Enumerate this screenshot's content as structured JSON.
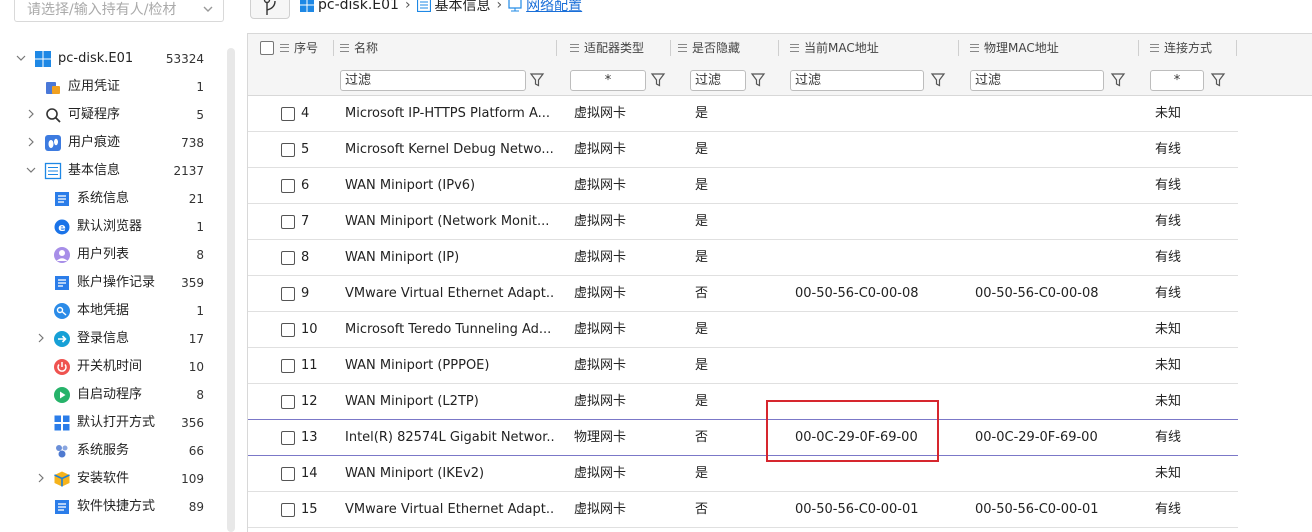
{
  "owner_select": {
    "placeholder": "请选择/输入持有人/检材"
  },
  "breadcrumb": {
    "items": [
      "pc-disk.E01",
      "基本信息",
      "网络配置"
    ]
  },
  "tree": [
    {
      "label": "pc-disk.E01",
      "count": "53324",
      "expand": "open",
      "icon": "windows-icon"
    },
    {
      "label": "应用凭证",
      "count": "1",
      "expand": "none",
      "icon": "credential-icon"
    },
    {
      "label": "可疑程序",
      "count": "5",
      "expand": "closed",
      "icon": "magnifier-icon"
    },
    {
      "label": "用户痕迹",
      "count": "738",
      "expand": "closed",
      "icon": "footprint-icon"
    },
    {
      "label": "基本信息",
      "count": "2137",
      "expand": "open",
      "icon": "list-icon"
    },
    {
      "label": "系统信息",
      "count": "21",
      "expand": "none",
      "icon": "system-info-icon"
    },
    {
      "label": "默认浏览器",
      "count": "1",
      "expand": "none",
      "icon": "browser-icon"
    },
    {
      "label": "用户列表",
      "count": "8",
      "expand": "none",
      "icon": "user-icon"
    },
    {
      "label": "账户操作记录",
      "count": "359",
      "expand": "none",
      "icon": "account-log-icon"
    },
    {
      "label": "本地凭据",
      "count": "1",
      "expand": "none",
      "icon": "key-icon"
    },
    {
      "label": "登录信息",
      "count": "17",
      "expand": "closed",
      "icon": "login-icon"
    },
    {
      "label": "开关机时间",
      "count": "10",
      "expand": "none",
      "icon": "power-icon"
    },
    {
      "label": "自启动程序",
      "count": "8",
      "expand": "none",
      "icon": "play-icon"
    },
    {
      "label": "默认打开方式",
      "count": "356",
      "expand": "none",
      "icon": "grid-icon"
    },
    {
      "label": "系统服务",
      "count": "66",
      "expand": "none",
      "icon": "service-icon"
    },
    {
      "label": "安装软件",
      "count": "109",
      "expand": "closed",
      "icon": "package-icon"
    },
    {
      "label": "软件快捷方式",
      "count": "89",
      "expand": "none",
      "icon": "shortcut-icon"
    }
  ],
  "columns": [
    {
      "key": "seq",
      "label": "序号"
    },
    {
      "key": "name",
      "label": "名称"
    },
    {
      "key": "adapter_type",
      "label": "适配器类型"
    },
    {
      "key": "hidden",
      "label": "是否隐藏"
    },
    {
      "key": "current_mac",
      "label": "当前MAC地址"
    },
    {
      "key": "physical_mac",
      "label": "物理MAC地址"
    },
    {
      "key": "connection",
      "label": "连接方式"
    }
  ],
  "filters": {
    "name": "过滤",
    "adapter_type": "*",
    "hidden": "过滤",
    "current_mac": "过滤",
    "physical_mac": "过滤",
    "connection": "*"
  },
  "rows": [
    {
      "seq": "4",
      "name": "Microsoft IP-HTTPS Platform A...",
      "adapter_type": "虚拟网卡",
      "hidden": "是",
      "current_mac": "",
      "physical_mac": "",
      "connection": "未知"
    },
    {
      "seq": "5",
      "name": "Microsoft Kernel Debug Netwo...",
      "adapter_type": "虚拟网卡",
      "hidden": "是",
      "current_mac": "",
      "physical_mac": "",
      "connection": "有线"
    },
    {
      "seq": "6",
      "name": "WAN Miniport (IPv6)",
      "adapter_type": "虚拟网卡",
      "hidden": "是",
      "current_mac": "",
      "physical_mac": "",
      "connection": "有线"
    },
    {
      "seq": "7",
      "name": "WAN Miniport (Network Monit...",
      "adapter_type": "虚拟网卡",
      "hidden": "是",
      "current_mac": "",
      "physical_mac": "",
      "connection": "有线"
    },
    {
      "seq": "8",
      "name": "WAN Miniport (IP)",
      "adapter_type": "虚拟网卡",
      "hidden": "是",
      "current_mac": "",
      "physical_mac": "",
      "connection": "有线"
    },
    {
      "seq": "9",
      "name": "VMware Virtual Ethernet Adapt...",
      "adapter_type": "虚拟网卡",
      "hidden": "否",
      "current_mac": "00-50-56-C0-00-08",
      "physical_mac": "00-50-56-C0-00-08",
      "connection": "有线"
    },
    {
      "seq": "10",
      "name": "Microsoft Teredo Tunneling Ad...",
      "adapter_type": "虚拟网卡",
      "hidden": "是",
      "current_mac": "",
      "physical_mac": "",
      "connection": "未知"
    },
    {
      "seq": "11",
      "name": "WAN Miniport (PPPOE)",
      "adapter_type": "虚拟网卡",
      "hidden": "是",
      "current_mac": "",
      "physical_mac": "",
      "connection": "未知"
    },
    {
      "seq": "12",
      "name": "WAN Miniport (L2TP)",
      "adapter_type": "虚拟网卡",
      "hidden": "是",
      "current_mac": "",
      "physical_mac": "",
      "connection": "未知"
    },
    {
      "seq": "13",
      "name": "Intel(R) 82574L Gigabit Networ...",
      "adapter_type": "物理网卡",
      "hidden": "否",
      "current_mac": "00-0C-29-0F-69-00",
      "physical_mac": "00-0C-29-0F-69-00",
      "connection": "有线"
    },
    {
      "seq": "14",
      "name": "WAN Miniport (IKEv2)",
      "adapter_type": "虚拟网卡",
      "hidden": "是",
      "current_mac": "",
      "physical_mac": "",
      "connection": "未知"
    },
    {
      "seq": "15",
      "name": "VMware Virtual Ethernet Adapt...",
      "adapter_type": "虚拟网卡",
      "hidden": "否",
      "current_mac": "00-50-56-C0-00-01",
      "physical_mac": "00-50-56-C0-00-01",
      "connection": "有线"
    }
  ],
  "selected_row": "13",
  "colors": {
    "accent": "#1a6fd8",
    "highlight": "#d6262e",
    "selection_line": "#7b78c8"
  }
}
